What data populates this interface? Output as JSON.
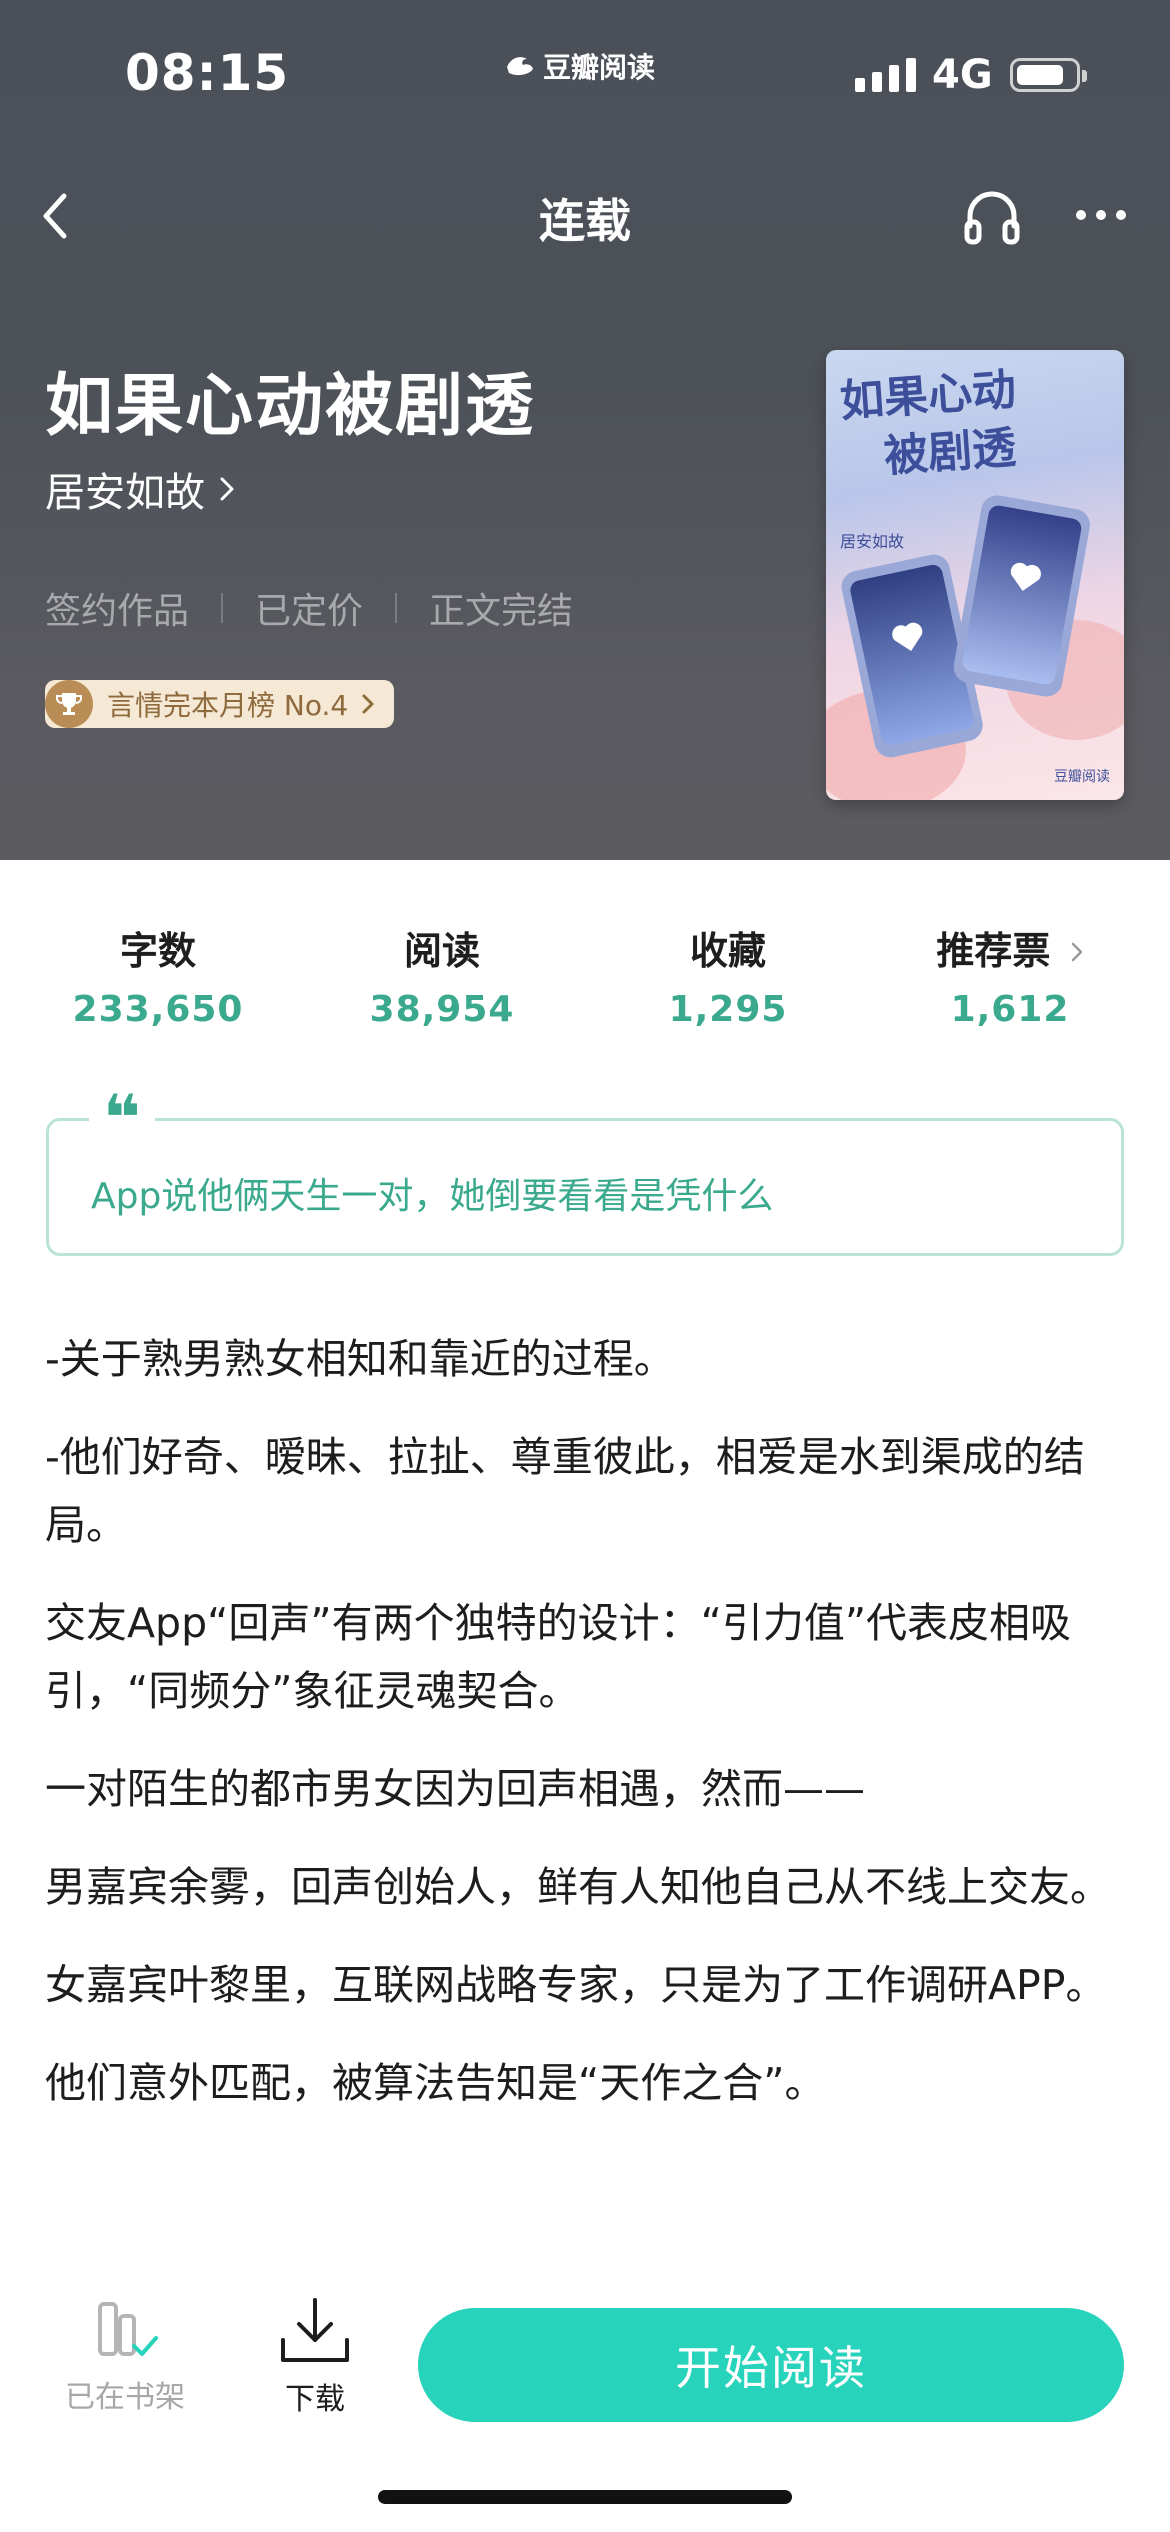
{
  "status_bar": {
    "time": "08:15",
    "brand": "豆瓣阅读",
    "network": "4G"
  },
  "nav": {
    "title": "连载"
  },
  "book": {
    "title": "如果心动被剧透",
    "author": "居安如故",
    "tags": [
      "签约作品",
      "已定价",
      "正文完结"
    ],
    "rank": "言情完本月榜 No.4",
    "cover": {
      "title_line1": "如果心动",
      "title_line2": "被剧透",
      "author": "居安如故",
      "publisher": "豆瓣阅读"
    }
  },
  "stats": [
    {
      "label": "字数",
      "value": "233,650"
    },
    {
      "label": "阅读",
      "value": "38,954"
    },
    {
      "label": "收藏",
      "value": "1,295"
    },
    {
      "label": "推荐票",
      "value": "1,612"
    }
  ],
  "quote": {
    "mark": "❝",
    "text": "App说他俩天生一对，她倒要看看是凭什么"
  },
  "synopsis": [
    "-关于熟男熟女相知和靠近的过程。",
    "-他们好奇、暧昧、拉扯、尊重彼此，相爱是水到渠成的结局。",
    "交友App“回声”有两个独特的设计：“引力值”代表皮相吸引，“同频分”象征灵魂契合。",
    "一对陌生的都市男女因为回声相遇，然而——",
    "男嘉宾余雾，回声创始人，鲜有人知他自己从不线上交友。",
    "女嘉宾叶黎里，互联网战略专家，只是为了工作调研APP。",
    "他们意外匹配，被算法告知是“天作之合”。"
  ],
  "bottom": {
    "shelf_label": "已在书架",
    "download_label": "下载",
    "start_label": "开始阅读"
  },
  "colors": {
    "accent": "#27d3bb",
    "stat_value": "#3aa98d",
    "hero_bg": "#4d5158"
  }
}
